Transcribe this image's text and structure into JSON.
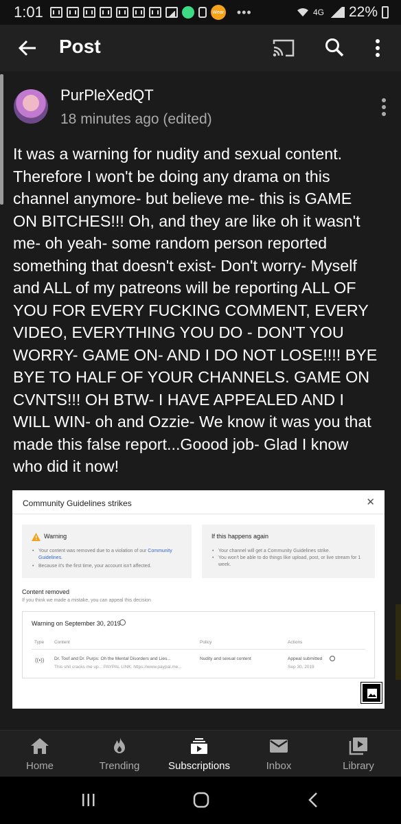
{
  "status_bar": {
    "time": "1:01",
    "network": "4G",
    "battery": "22%",
    "notification_icons": [
      "gmail-icon",
      "gmail-icon",
      "gmail-icon",
      "gmail-icon",
      "gmail-icon",
      "gmail-icon",
      "gmail-icon",
      "image-icon",
      "android-icon",
      "lock-icon",
      "wear-icon"
    ],
    "wear_label": "Wear"
  },
  "app_bar": {
    "title": "Post"
  },
  "post": {
    "author": "PurPleXedQT",
    "timestamp": "18 minutes ago (edited)",
    "body": "It was a warning for nudity and sexual content.\nTherefore I won't be doing any drama on this\nchannel anymore- but believe me- this is GAME\nON BITCHES!!! Oh, and they are like oh it wasn't\nme- oh yeah- some random person reported\nsomething that doesn't exist- Don't worry- Myself\nand ALL of my patreons will be reporting ALL OF\nYOU FOR EVERY FUCKING COMMENT, EVERY\nVIDEO, EVERYTHING YOU DO - DON'T YOU\nWORRY- GAME ON- AND I DO NOT LOSE!!!! BYE\nBYE TO HALF OF YOUR CHANNELS.  GAME ON\nCVNTS!!! OH BTW- I HAVE APPEALED AND I\nWILL WIN- oh and Ozzie- We know it was you that\nmade this false report...Goood job- Glad I know\nwho did it now!"
  },
  "attached_image": {
    "title": "Community Guidelines strikes",
    "close": "✕",
    "warning": {
      "title": "Warning",
      "bullet1_pre": "Your content was removed due to a violation of our ",
      "bullet1_link": "Community Guidelines",
      "bullet1_post": ".",
      "bullet2": "Because it's the first time, your account isn't affected."
    },
    "if_again": {
      "title": "If this happens again",
      "bullet1": "Your channel will get a Community Guidelines strike.",
      "bullet2": "You won't be able to do things like upload, post, or live stream for 1 week."
    },
    "content_removed": {
      "title": "Content removed",
      "subtitle": "If you think we made a mistake, you can appeal this decision"
    },
    "table": {
      "heading": "Warning on September 30, 2019",
      "columns": [
        "Type",
        "Content",
        "Policy",
        "Actions"
      ],
      "row": {
        "content_title": "Dr. Toof and Dr. Purps: Oh the Mental Disorders and Lies...",
        "content_sub": "This shit cracks me up... PAYPAL LINK: https://www.paypal.me...",
        "policy": "Nudity and sexual content",
        "action": "Appeal submitted",
        "action_date": "Sep 30, 2019"
      }
    }
  },
  "bottom_nav": [
    {
      "label": "Home",
      "icon": "home-icon",
      "active": false
    },
    {
      "label": "Trending",
      "icon": "trending-flame-icon",
      "active": false
    },
    {
      "label": "Subscriptions",
      "icon": "subscriptions-icon",
      "active": true
    },
    {
      "label": "Inbox",
      "icon": "inbox-mail-icon",
      "active": false
    },
    {
      "label": "Library",
      "icon": "library-icon",
      "active": false
    }
  ],
  "colors": {
    "background": "#1b1b1b",
    "app_bar": "#212121",
    "text_secondary": "#aaaaaa",
    "link": "#3366cc"
  }
}
